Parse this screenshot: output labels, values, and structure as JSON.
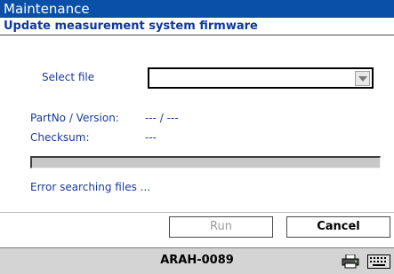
{
  "window": {
    "title": "Maintenance"
  },
  "header": {
    "subtitle": "Update measurement system firmware"
  },
  "form": {
    "select_file_label": "Select file",
    "select_file_value": "",
    "partno_label": "PartNo / Version:",
    "partno_value": "--- / ---",
    "checksum_label": "Checksum:",
    "checksum_value": "---",
    "progress": 0,
    "status_message": "Error searching files ..."
  },
  "buttons": {
    "run_label": "Run",
    "cancel_label": "Cancel"
  },
  "statusbar": {
    "device_name": "ARAH-0089",
    "icons": [
      "printer-icon",
      "keyboard-icon"
    ]
  },
  "colors": {
    "titlebar": "#0a50a8",
    "label_text": "#1a3a9c",
    "statusbar": "#d4d4d4"
  }
}
